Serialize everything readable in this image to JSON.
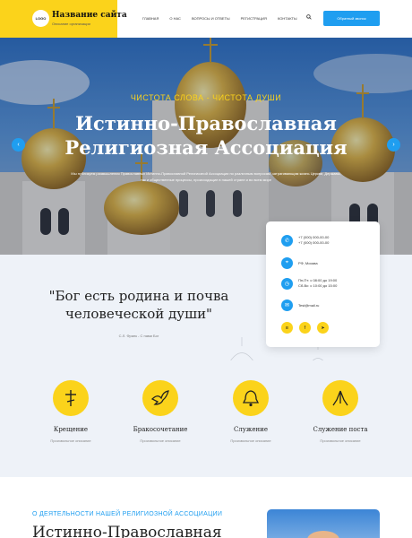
{
  "header": {
    "logo_text": "LOGO",
    "site_name": "Название сайта",
    "site_sub": "Описание организации",
    "nav": [
      "Главная",
      "О нас",
      "Вопросы и ответы",
      "Регистрация",
      "Контакты"
    ],
    "call_button": "Обратный звонок"
  },
  "hero": {
    "tagline": "ЧИСТОТА СЛОВА - ЧИСТОТА ДУШИ",
    "title_line1": "Истинно-Православная",
    "title_line2": "Религиозная Ассоциация",
    "description": "Мы публикуем размышления Православных Истинно-Православной Религиозной Ассоциации по различным вопросам, затрагивающим жизнь Церкви, Державы, так и общественные процессы, происходящие в нашей стране и во всем мире",
    "prev_arrow": "‹",
    "next_arrow": "›"
  },
  "contacts": {
    "phone1": "+7 (000) 000-00-00",
    "phone2": "+7 (000) 000-00-00",
    "address": "РФ, Москва",
    "hours1": "Пн-Пт: с 08:00 до 19:00",
    "hours2": "Сб-Вс: с 10:00 до 15:00",
    "email": "Test@mail.ru"
  },
  "quote": {
    "line1": "\"Бог есть родина и почва",
    "line2": "человеческой души\"",
    "author": "С.Л. Франк - С нами Бог"
  },
  "services": [
    {
      "icon": "cross-icon",
      "title": "Крещение",
      "desc": "Произвольное описание"
    },
    {
      "icon": "dove-icon",
      "title": "Бракосочетание",
      "desc": "Произвольное описание"
    },
    {
      "icon": "bell-icon",
      "title": "Служение",
      "desc": "Произвольное описание"
    },
    {
      "icon": "praying-hands-icon",
      "title": "Служение поста",
      "desc": "Произвольное описание"
    }
  ],
  "about": {
    "tag": "О ДЕЯТЕЛЬНОСТИ НАШЕЙ РЕЛИГИОЗНОЙ АССОЦИАЦИИ",
    "title": "Истинно-Православная"
  },
  "colors": {
    "accent_yellow": "#fbd31b",
    "accent_blue": "#1f9ef0"
  }
}
